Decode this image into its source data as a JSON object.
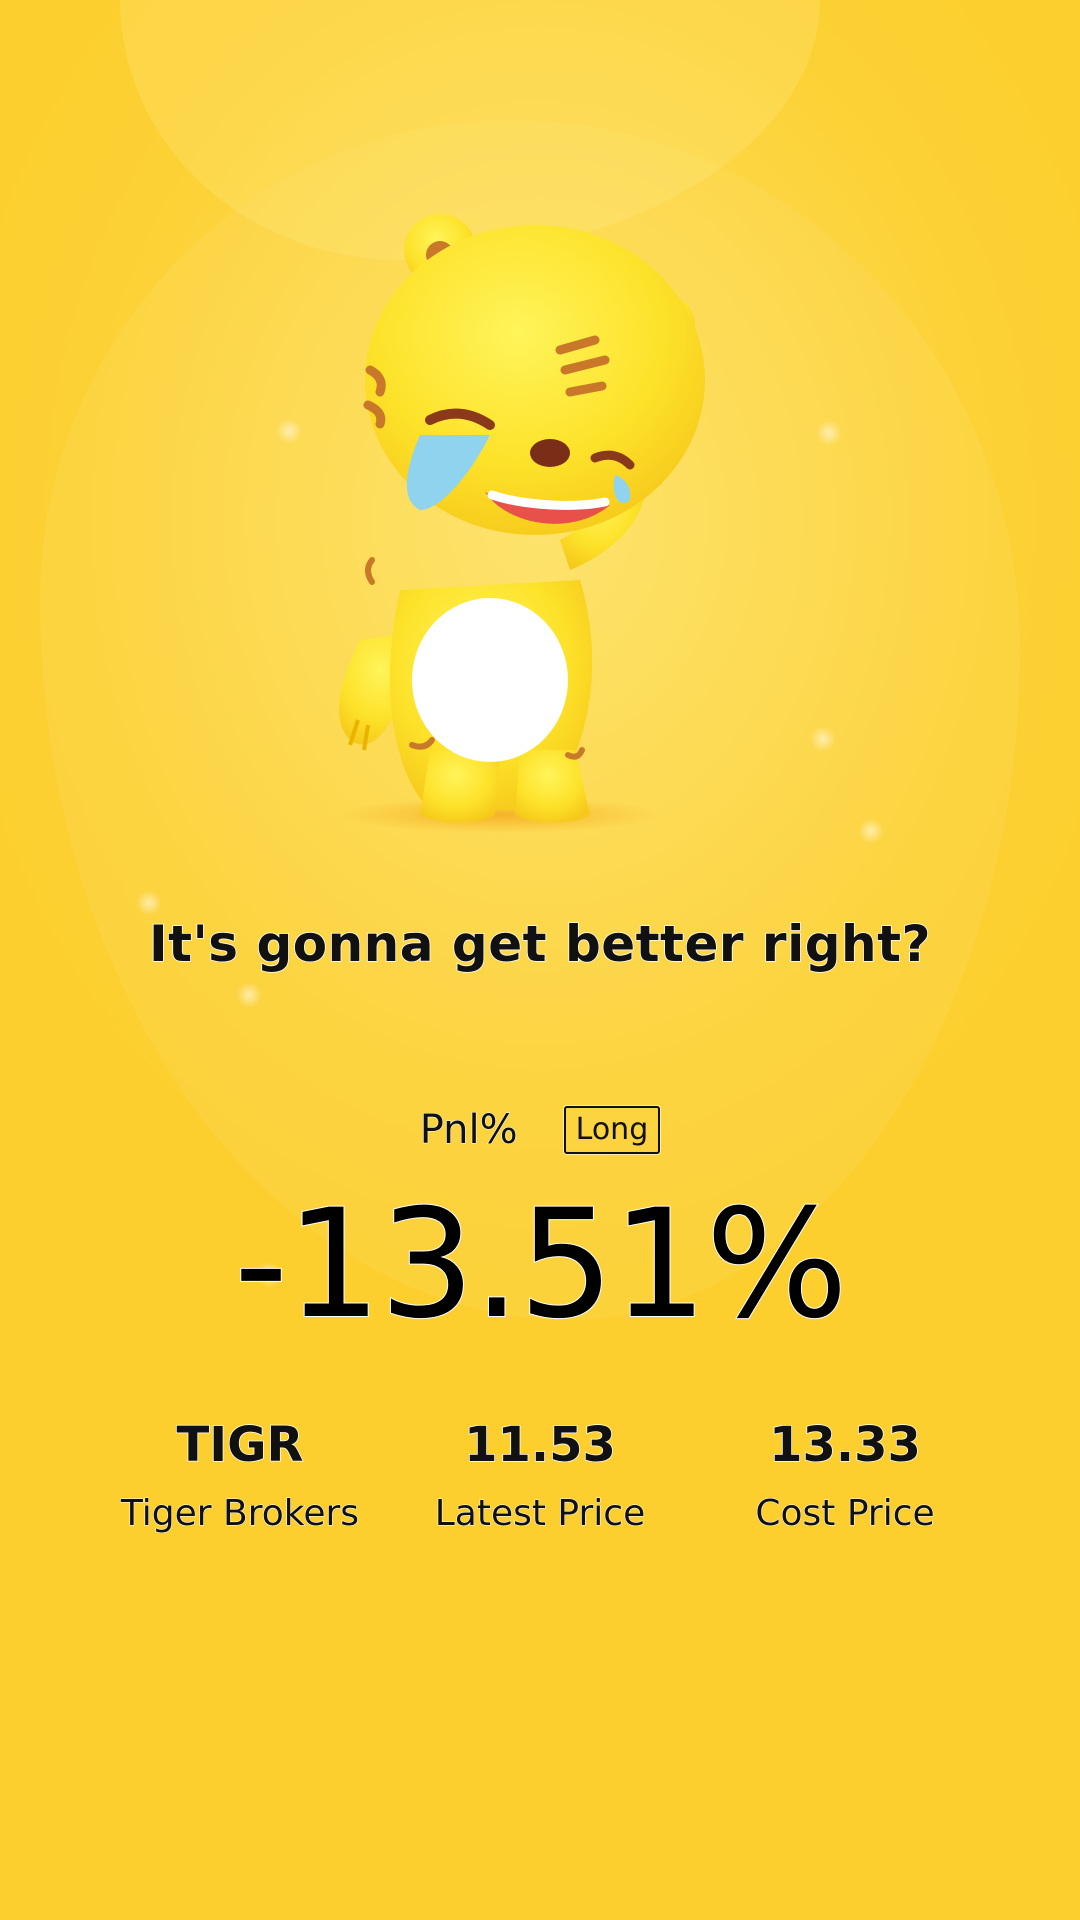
{
  "screen": {
    "background_color": "#fcd134",
    "mascot": "crying-tiger-mascot"
  },
  "message": {
    "tagline": "It's gonna get better right?"
  },
  "position": {
    "pnl_label": "Pnl%",
    "direction_badge": "Long",
    "pnl_value": "-13.51%"
  },
  "stats": {
    "ticker": "TIGR",
    "company_name": "Tiger Brokers",
    "latest_price": "11.53",
    "latest_price_label": "Latest Price",
    "cost_price": "13.33",
    "cost_price_label": "Cost Price"
  }
}
